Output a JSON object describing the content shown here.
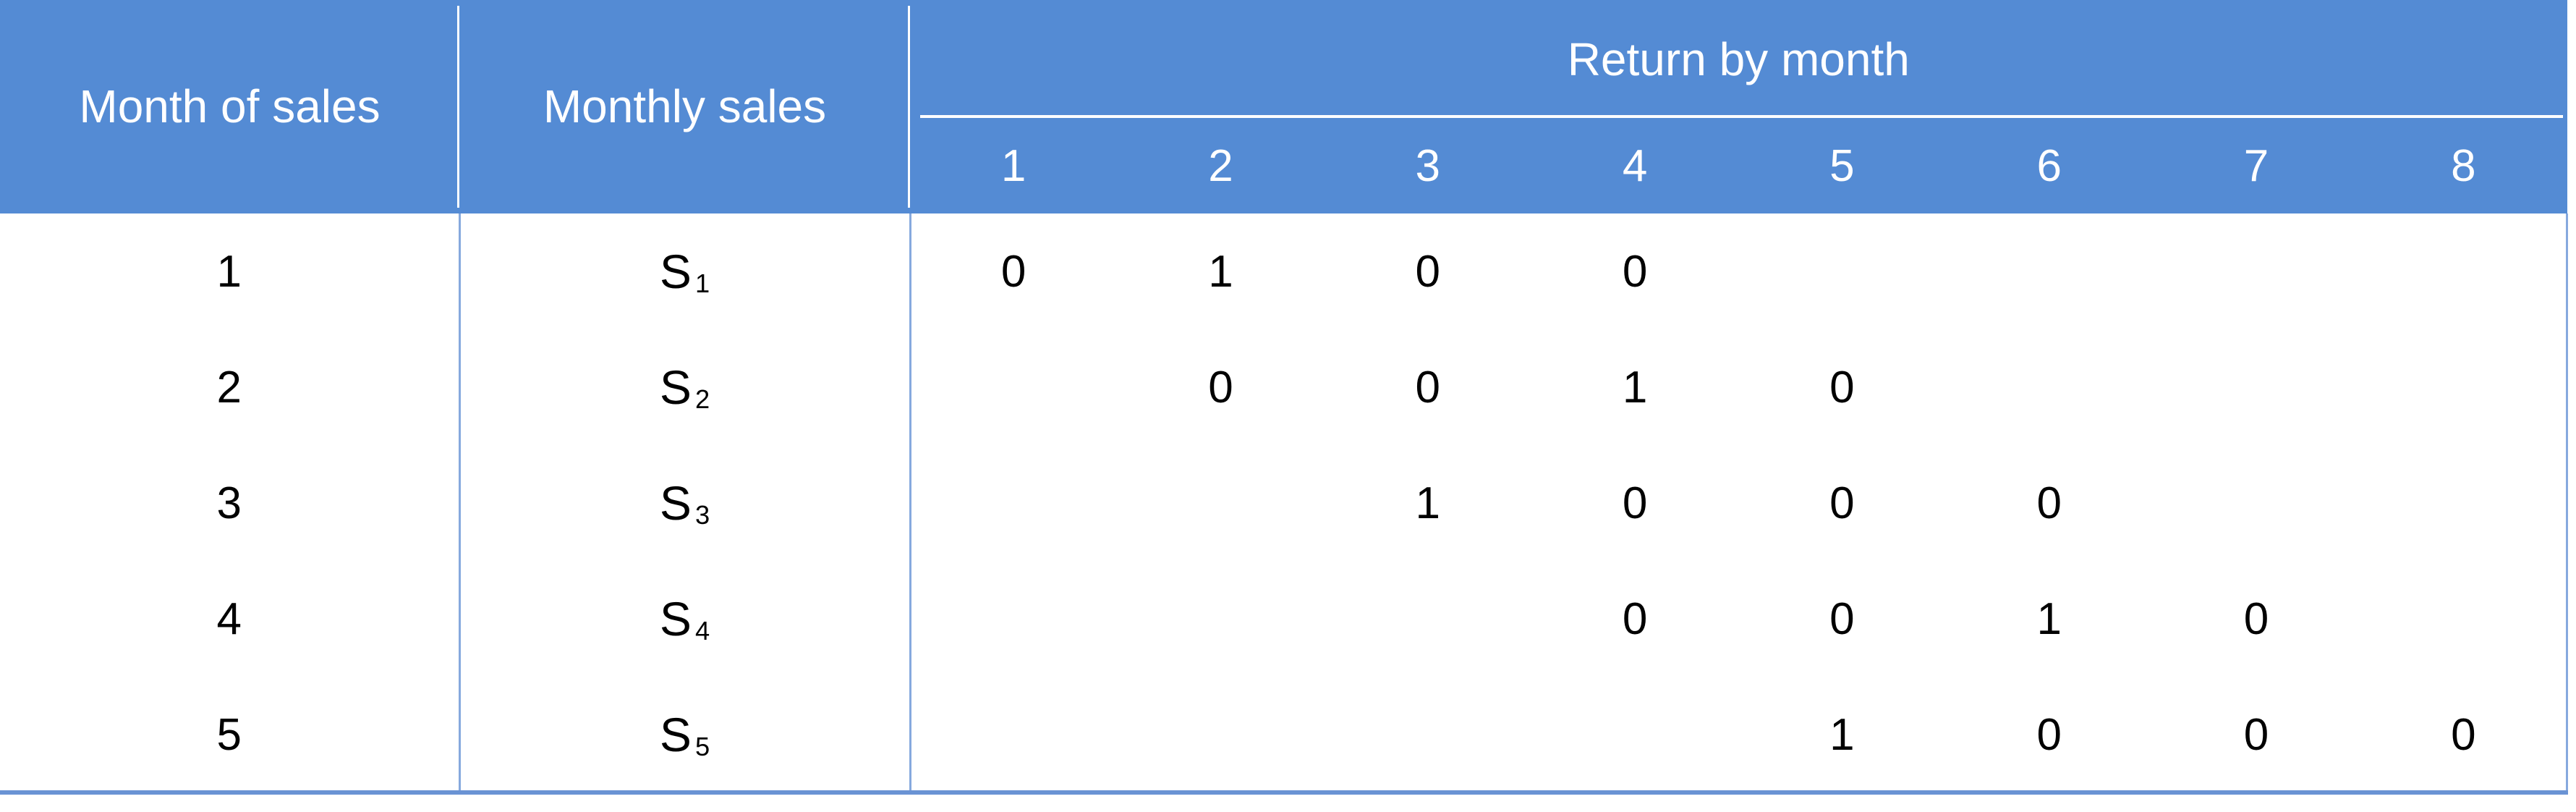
{
  "table": {
    "headers": {
      "month_of_sales": "Month of sales",
      "monthly_sales": "Monthly sales",
      "return_group": "Return by month",
      "return_months": [
        "1",
        "2",
        "3",
        "4",
        "5",
        "6",
        "7",
        "8"
      ]
    },
    "rows": [
      {
        "month_of_sales": "1",
        "monthly_sales_base": "S",
        "monthly_sales_sub": "1",
        "returns": [
          "0",
          "1",
          "0",
          "0",
          "",
          "",
          "",
          ""
        ]
      },
      {
        "month_of_sales": "2",
        "monthly_sales_base": "S",
        "monthly_sales_sub": "2",
        "returns": [
          "",
          "0",
          "0",
          "1",
          "0",
          "",
          "",
          ""
        ]
      },
      {
        "month_of_sales": "3",
        "monthly_sales_base": "S",
        "monthly_sales_sub": "3",
        "returns": [
          "",
          "",
          "1",
          "0",
          "0",
          "0",
          "",
          ""
        ]
      },
      {
        "month_of_sales": "4",
        "monthly_sales_base": "S",
        "monthly_sales_sub": "4",
        "returns": [
          "",
          "",
          "",
          "0",
          "0",
          "1",
          "0",
          ""
        ]
      },
      {
        "month_of_sales": "5",
        "monthly_sales_base": "S",
        "monthly_sales_sub": "5",
        "returns": [
          "",
          "",
          "",
          "",
          "1",
          "0",
          "0",
          "0"
        ]
      }
    ]
  },
  "colors": {
    "header_background": "#548BD4",
    "header_text": "#FFFFFF",
    "body_text": "#000000",
    "grid_line": "#86A9DE",
    "bottom_rule": "#6A93D4",
    "body_background": "#FFFFFF"
  }
}
